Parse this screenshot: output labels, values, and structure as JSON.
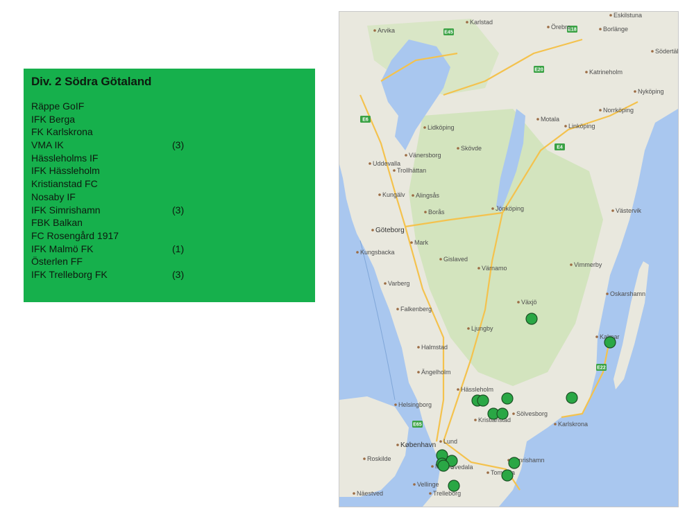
{
  "league": {
    "title": "Div. 2 Södra Götaland",
    "teams": [
      {
        "name": "Räppe GoIF",
        "note": ""
      },
      {
        "name": "IFK Berga",
        "note": ""
      },
      {
        "name": "FK Karlskrona",
        "note": ""
      },
      {
        "name": "VMA IK",
        "note": "(3)"
      },
      {
        "name": "Hässleholms IF",
        "note": ""
      },
      {
        "name": "IFK Hässleholm",
        "note": ""
      },
      {
        "name": "Kristianstad FC",
        "note": ""
      },
      {
        "name": "Nosaby IF",
        "note": ""
      },
      {
        "name": "IFK Simrishamn",
        "note": "(3)"
      },
      {
        "name": "FBK Balkan",
        "note": ""
      },
      {
        "name": "FC Rosengård 1917",
        "note": ""
      },
      {
        "name": "IFK Malmö FK",
        "note": "(1)"
      },
      {
        "name": "Österlen FF",
        "note": ""
      },
      {
        "name": "IFK Trelleborg FK",
        "note": "(3)"
      }
    ]
  },
  "map": {
    "colors": {
      "water": "#a9c7ef",
      "land": "#e9e8de",
      "forest": "#cfe3b8",
      "road": "#f4c24d",
      "marker": "#2aa745"
    },
    "places": [
      {
        "name": "Karlstad",
        "big": false
      },
      {
        "name": "Örebro",
        "big": false
      },
      {
        "name": "Eskilstuna",
        "big": false
      },
      {
        "name": "Nyköping",
        "big": false
      },
      {
        "name": "Norrköping",
        "big": false
      },
      {
        "name": "Linköping",
        "big": false
      },
      {
        "name": "Lidköping",
        "big": false
      },
      {
        "name": "Vänersborg",
        "big": false
      },
      {
        "name": "Skövde",
        "big": false
      },
      {
        "name": "Motala",
        "big": false
      },
      {
        "name": "Uddevalla",
        "big": false
      },
      {
        "name": "Trollhättan",
        "big": false
      },
      {
        "name": "Alingsås",
        "big": false
      },
      {
        "name": "Kungälv",
        "big": false
      },
      {
        "name": "Jönköping",
        "big": false
      },
      {
        "name": "Göteborg",
        "big": true
      },
      {
        "name": "Borås",
        "big": false
      },
      {
        "name": "Kungsbacka",
        "big": false
      },
      {
        "name": "Mark",
        "big": false
      },
      {
        "name": "Gislaved",
        "big": false
      },
      {
        "name": "Värnamo",
        "big": false
      },
      {
        "name": "Västervik",
        "big": false
      },
      {
        "name": "Varberg",
        "big": false
      },
      {
        "name": "Falkenberg",
        "big": false
      },
      {
        "name": "Växjö",
        "big": false
      },
      {
        "name": "Kalmar",
        "big": false
      },
      {
        "name": "Ljungby",
        "big": false
      },
      {
        "name": "Halmstad",
        "big": false
      },
      {
        "name": "Ängelholm",
        "big": false
      },
      {
        "name": "Helsingborg",
        "big": false
      },
      {
        "name": "Hässleholm",
        "big": false
      },
      {
        "name": "Kristianstad",
        "big": false
      },
      {
        "name": "Karlskrona",
        "big": false
      },
      {
        "name": "Sölvesborg",
        "big": false
      },
      {
        "name": "København",
        "big": true
      },
      {
        "name": "Lund",
        "big": false
      },
      {
        "name": "Malmö",
        "big": false
      },
      {
        "name": "Trelleborg",
        "big": false
      },
      {
        "name": "Simrishamn",
        "big": false
      },
      {
        "name": "Tomelilla",
        "big": false
      },
      {
        "name": "Svedala",
        "big": false
      },
      {
        "name": "Roskilde",
        "big": false
      },
      {
        "name": "Vellinge",
        "big": false
      },
      {
        "name": "Näestved",
        "big": false
      },
      {
        "name": "Katrineholm",
        "big": false
      },
      {
        "name": "Borlänge",
        "big": false
      },
      {
        "name": "Södertälje",
        "big": false
      },
      {
        "name": "Arvika",
        "big": false
      },
      {
        "name": "Vimmerby",
        "big": false
      },
      {
        "name": "Oskarshamn",
        "big": false
      }
    ],
    "routes": [
      "E6",
      "E4",
      "E20",
      "E18",
      "E22",
      "E65",
      "E45"
    ],
    "markers": [
      {
        "name": "Växjö"
      },
      {
        "name": "Kalmar"
      },
      {
        "name": "Hässleholm"
      },
      {
        "name": "Hässleholm"
      },
      {
        "name": "Hässleholm"
      },
      {
        "name": "Kristianstad"
      },
      {
        "name": "Kristianstad"
      },
      {
        "name": "Karlskrona"
      },
      {
        "name": "Malmö"
      },
      {
        "name": "Malmö"
      },
      {
        "name": "Malmö"
      },
      {
        "name": "Malmö"
      },
      {
        "name": "Simrishamn"
      },
      {
        "name": "Tomelilla"
      },
      {
        "name": "Trelleborg"
      }
    ]
  }
}
